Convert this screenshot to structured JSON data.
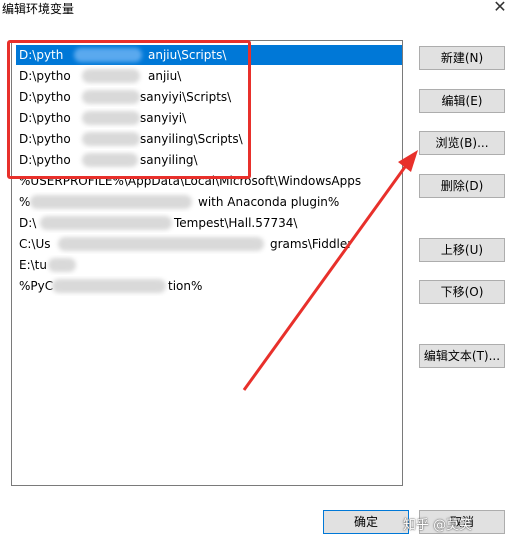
{
  "window": {
    "title": "编辑环境变量",
    "close_glyph": "✕"
  },
  "list": {
    "items": [
      {
        "text": "D:\\pyth",
        "tail": "anjiu\\Scripts\\",
        "selected": true
      },
      {
        "text": "D:\\pytho",
        "tail": "anjiu\\",
        "selected": false
      },
      {
        "text": "D:\\pytho",
        "tail": "sanyiyi\\Scripts\\",
        "selected": false
      },
      {
        "text": "D:\\pytho",
        "tail": "sanyiyi\\",
        "selected": false
      },
      {
        "text": "D:\\pytho",
        "tail": "sanyiling\\Scripts\\",
        "selected": false
      },
      {
        "text": "D:\\pytho",
        "tail": "sanyiling\\",
        "selected": false
      },
      {
        "text": "%USERPROFILE%\\AppData\\Local\\Microsoft\\WindowsApps",
        "tail": "",
        "selected": false
      },
      {
        "text": "%",
        "tail": "with Anaconda plugin%",
        "selected": false
      },
      {
        "text": "D:\\",
        "tail": "Tempest\\Hall.57734\\",
        "selected": false
      },
      {
        "text": "C:\\Us",
        "tail": "grams\\Fiddler",
        "selected": false
      },
      {
        "text": "E:\\tu",
        "tail": "",
        "selected": false
      },
      {
        "text": "%PyC",
        "tail": "tion%",
        "selected": false
      }
    ]
  },
  "buttons": {
    "new": "新建(N)",
    "edit": "编辑(E)",
    "browse": "浏览(B)...",
    "delete": "删除(D)",
    "move_up": "上移(U)",
    "move_down": "下移(O)",
    "edit_text": "编辑文本(T)...",
    "ok": "确定",
    "cancel": "取消"
  },
  "watermark": "知乎 @莫笑",
  "colors": {
    "selection": "#0078d7",
    "annotation_red": "#e8302b"
  }
}
